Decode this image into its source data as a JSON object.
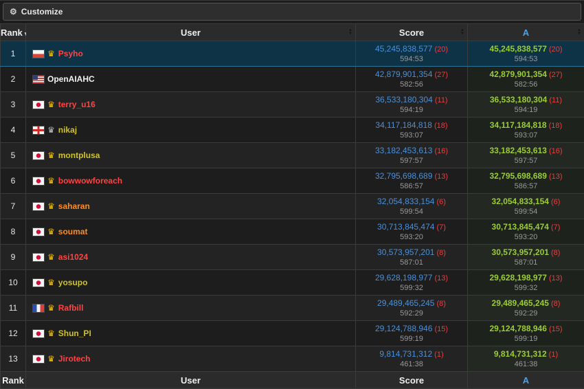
{
  "customize": {
    "label": "Customize"
  },
  "icons": {
    "gear": "⚙",
    "sort_up": "▲",
    "sort_down": "▼",
    "sort_caret": "▾",
    "crown": "♛"
  },
  "table": {
    "headers": {
      "rank": "Rank",
      "user": "User",
      "score": "Score",
      "problem_a": "A"
    }
  },
  "colors": {
    "score_blue": "#4a90d9",
    "accepted_green": "#9acd32",
    "penalty_red": "#f23b3b",
    "time_gray": "#999999",
    "header_a_blue": "#4aa3e8",
    "user_red": "#ff4343",
    "user_orange": "#ff8c1a",
    "user_yellow": "#cfc223",
    "user_white": "#f2f2f2",
    "crown_gold": "#f2c112",
    "crown_silver": "#c0c0c0",
    "highlight_bg": "#0e3347",
    "highlight_border": "#2b7598"
  },
  "rows": [
    {
      "rank": "1",
      "user": "Psyho",
      "flag": "pl",
      "crown": "gold",
      "color": "red",
      "score": "45,245,838,577",
      "penalty": "(20)",
      "time": "594:53",
      "highlight": true
    },
    {
      "rank": "2",
      "user": "OpenAIAHC",
      "flag": "us",
      "crown": null,
      "color": "white",
      "score": "42,879,901,354",
      "penalty": "(27)",
      "time": "582:56",
      "highlight": false
    },
    {
      "rank": "3",
      "user": "terry_u16",
      "flag": "jp",
      "crown": "gold",
      "color": "red",
      "score": "36,533,180,304",
      "penalty": "(11)",
      "time": "594:19",
      "highlight": false
    },
    {
      "rank": "4",
      "user": "nikaj",
      "flag": "gb-eng",
      "crown": "silver",
      "color": "yellow",
      "score": "34,117,184,818",
      "penalty": "(18)",
      "time": "593:07",
      "highlight": false
    },
    {
      "rank": "5",
      "user": "montplusa",
      "flag": "jp",
      "crown": "gold",
      "color": "yellow",
      "score": "33,182,453,613",
      "penalty": "(16)",
      "time": "597:57",
      "highlight": false
    },
    {
      "rank": "6",
      "user": "bowwowforeach",
      "flag": "jp",
      "crown": "gold",
      "color": "red",
      "score": "32,795,698,689",
      "penalty": "(13)",
      "time": "586:57",
      "highlight": false
    },
    {
      "rank": "7",
      "user": "saharan",
      "flag": "jp",
      "crown": "gold",
      "color": "orange",
      "score": "32,054,833,154",
      "penalty": "(6)",
      "time": "599:54",
      "highlight": false
    },
    {
      "rank": "8",
      "user": "soumat",
      "flag": "jp",
      "crown": "gold",
      "color": "orange",
      "score": "30,713,845,474",
      "penalty": "(7)",
      "time": "593:20",
      "highlight": false
    },
    {
      "rank": "9",
      "user": "asi1024",
      "flag": "jp",
      "crown": "gold",
      "color": "red",
      "score": "30,573,957,201",
      "penalty": "(8)",
      "time": "587:01",
      "highlight": false
    },
    {
      "rank": "10",
      "user": "yosupo",
      "flag": "jp",
      "crown": "gold",
      "color": "yellow",
      "score": "29,628,198,977",
      "penalty": "(13)",
      "time": "599:32",
      "highlight": false
    },
    {
      "rank": "11",
      "user": "Rafbill",
      "flag": "fr",
      "crown": "gold",
      "color": "red",
      "score": "29,489,465,245",
      "penalty": "(8)",
      "time": "592:29",
      "highlight": false
    },
    {
      "rank": "12",
      "user": "Shun_PI",
      "flag": "jp",
      "crown": "gold",
      "color": "yellow",
      "score": "29,124,788,946",
      "penalty": "(15)",
      "time": "599:19",
      "highlight": false
    },
    {
      "rank": "13",
      "user": "Jirotech",
      "flag": "jp",
      "crown": "gold",
      "color": "red",
      "score": "9,814,731,312",
      "penalty": "(1)",
      "time": "461:38",
      "highlight": false
    }
  ]
}
